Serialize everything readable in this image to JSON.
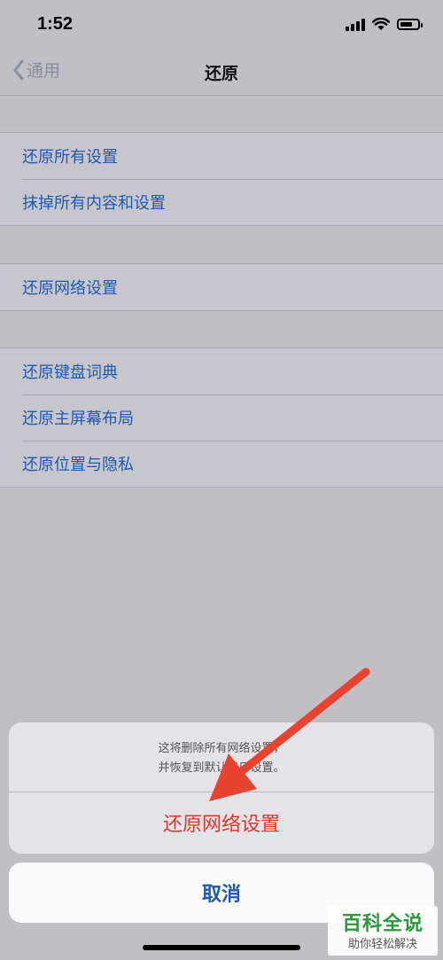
{
  "status": {
    "time": "1:52",
    "battery_level": 0.7,
    "icons": [
      "signal-icon",
      "wifi-icon",
      "battery-icon"
    ]
  },
  "nav": {
    "back_label": "通用",
    "title": "还原"
  },
  "groups": [
    [
      "还原所有设置",
      "抹掉所有内容和设置"
    ],
    [
      "还原网络设置"
    ],
    [
      "还原键盘词典",
      "还原主屏幕布局",
      "还原位置与隐私"
    ]
  ],
  "sheet": {
    "message_line1": "这将删除所有网络设置，",
    "message_line2": "并恢复到默认出厂设置。",
    "action": "还原网络设置",
    "cancel": "取消"
  },
  "watermark": {
    "title": "百科全说",
    "subtitle": "助你轻松解决"
  },
  "colors": {
    "link": "#1f5ab0",
    "destructive": "#e0372c",
    "arrow": "#e8432e",
    "brand": "#2a9a3c"
  }
}
